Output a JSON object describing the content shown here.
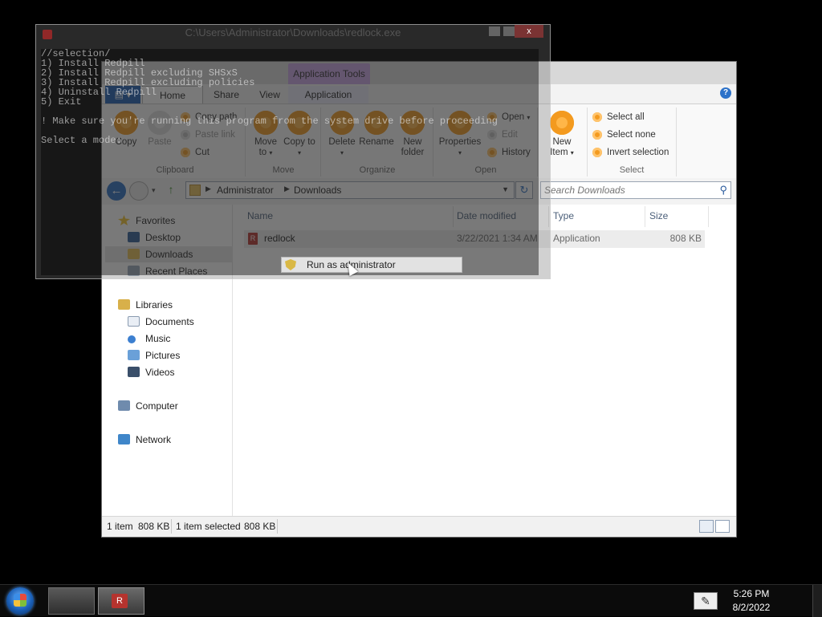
{
  "console": {
    "title": "C:\\Users\\Administrator\\Downloads\\redlock.exe",
    "close_glyph": "x",
    "lines": [
      "//selection/",
      "1) Install Redpill",
      "2) Install Redpill excluding SHSxS",
      "3) Install Redpill excluding policies",
      "4) Uninstall Redpill",
      "5) Exit",
      "",
      "! Make sure you're running this program from the system drive before proceeding",
      "",
      "Select a mode:"
    ]
  },
  "ribbon": {
    "context_label": "Application Tools",
    "tabs": {
      "file": "",
      "home": "Home",
      "share": "Share",
      "view": "View",
      "application": "Application"
    },
    "help_glyph": "?",
    "clipboard": {
      "name": "Clipboard",
      "copy": "Copy",
      "paste": "Paste",
      "copy_path": "Copy path",
      "paste_link": "Paste link",
      "cut": "Cut"
    },
    "organize": {
      "name": "Organize",
      "move_to": "Move to",
      "copy_to": "Copy to",
      "delete": "Delete",
      "rename": "Rename",
      "new_folder": "New folder"
    },
    "move_group": "Move",
    "open": {
      "name": "Open",
      "properties": "Properties",
      "open": "Open",
      "edit": "Edit",
      "history": "History"
    },
    "new": {
      "new_item": "New Item"
    },
    "select": {
      "name": "Select",
      "select_all": "Select all",
      "select_none": "Select none",
      "invert_selection": "Invert selection"
    }
  },
  "address": {
    "crumbs": [
      "Administrator",
      "Downloads"
    ],
    "search_placeholder": "Search Downloads"
  },
  "nav": {
    "favorites": "Favorites",
    "desktop": "Desktop",
    "downloads": "Downloads",
    "recent_places": "Recent Places",
    "libraries": "Libraries",
    "documents": "Documents",
    "music": "Music",
    "pictures": "Pictures",
    "videos": "Videos",
    "computer": "Computer",
    "network": "Network"
  },
  "columns": {
    "name": "Name",
    "date_modified": "Date modified",
    "type": "Type",
    "size": "Size"
  },
  "files": [
    {
      "name": "redlock",
      "date_modified": "3/22/2021 1:34 AM",
      "type": "Application",
      "size": "808 KB"
    }
  ],
  "context_menu": {
    "run_as_admin": "Run as administrator"
  },
  "status": {
    "items": "1 item",
    "items_size": "808 KB",
    "selected": "1 item selected",
    "selected_size": "808 KB"
  },
  "taskbar": {
    "time": "5:26 PM",
    "date": "8/2/2022",
    "redlock_icon_letter": "R"
  },
  "colors": {
    "accent_blue": "#1e5fb4",
    "ribbon_icon": "#f39a1f",
    "context_tab": "#c9a4e6"
  }
}
